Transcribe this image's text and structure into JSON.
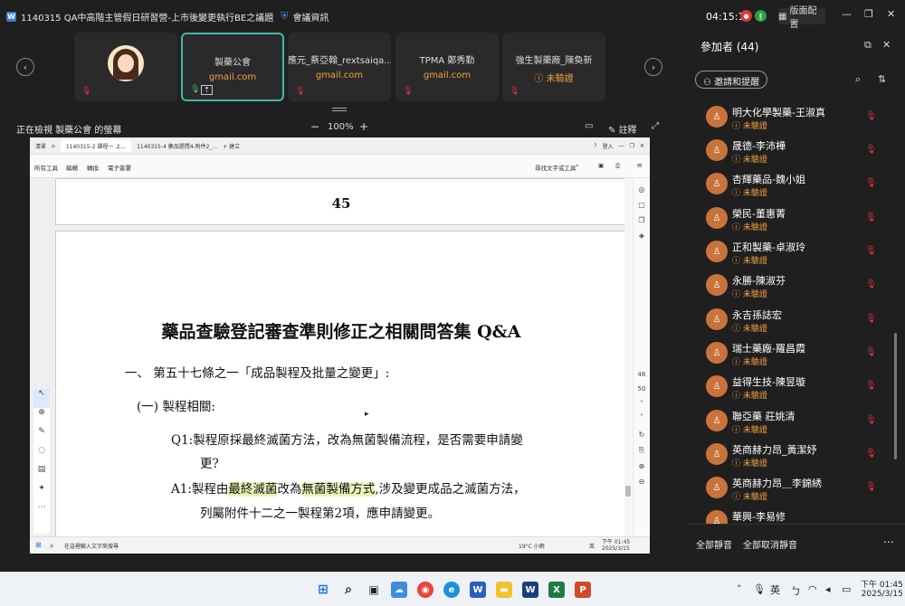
{
  "window": {
    "title": "1140315 QA中高階主管假日研習營-上市後變更執行BE之議題",
    "meeting_info": "會議資訊",
    "time": "04:15:12",
    "layout_label": "版面配置"
  },
  "video_tiles": [
    {
      "name": "",
      "email": ""
    },
    {
      "name": "製藥公會",
      "email": "gmail.com"
    },
    {
      "name": "應元_蔡亞翰_rextsaiqa...",
      "email": "gmail.com"
    },
    {
      "name": "TPMA 鄭秀勤",
      "email": "gmail.com"
    },
    {
      "name": "強生製藥廠_陳奐新",
      "email": "未驗證"
    }
  ],
  "viewing": {
    "label": "正在檢視 製藥公會 的螢幕",
    "zoom": "100%",
    "annotate_label": "註釋"
  },
  "shared_screen": {
    "tabs": [
      "清單",
      "1140315-2 課程一 上...",
      "1140315-4 藥品提問4-附件2_...",
      "+ 建立"
    ],
    "login_label": "登入",
    "toolbar_items": [
      "所有工具",
      "編輯",
      "轉換",
      "電子簽署"
    ],
    "search_label": "尋找文字或工具",
    "page_number_header": "45",
    "doc_title": "藥品查驗登記審查準則修正之相關問答集 Q&A",
    "section_heading": "一、  第五十七條之一「成品製程及批量之變更」:",
    "subsection": "(一) 製程相關:",
    "q1_line1": "Q1:製程原採最終滅菌方法，改為無菌製備流程，是否需要申請變",
    "q1_line2": "更?",
    "a1_prefix": "A1:製程由",
    "a1_hl1": "最終滅菌",
    "a1_mid": "改為",
    "a1_hl2": "無菌製備方式",
    "a1_suffix": ",涉及變更成品之滅菌方法，",
    "a1_line2": "列屬附件十二之一製程第2項，應申請變更。",
    "side_page_current": "46",
    "side_page_total": "50",
    "inner_taskbar": {
      "search_placeholder": "在這裡輸入文字來搜尋",
      "weather": "19°C 小雨",
      "lang": "英",
      "time": "下午 01:45",
      "date": "2025/3/15"
    }
  },
  "participants": {
    "title": "參加者 (44)",
    "invite_label": "邀請和提醒",
    "list": [
      {
        "name": "明大化學製藥-王淑真",
        "status": "未驗證"
      },
      {
        "name": "晟德-李沛樺",
        "status": "未驗證"
      },
      {
        "name": "杏輝藥品-魏小姐",
        "status": "未驗證"
      },
      {
        "name": "榮民-董惠菁",
        "status": "未驗證"
      },
      {
        "name": "正和製藥-卓淑玲",
        "status": "未驗證"
      },
      {
        "name": "永勝-陳淑芬",
        "status": "未驗證"
      },
      {
        "name": "永吉孫誌宏",
        "status": "未驗證"
      },
      {
        "name": "瑞士藥廠-羅昌霞",
        "status": "未驗證"
      },
      {
        "name": "益得生技-陳昱璇",
        "status": "未驗證"
      },
      {
        "name": "聯亞藥 莊姚清",
        "status": "未驗證"
      },
      {
        "name": "英商赫力昂_黃潔妤",
        "status": "未驗證"
      },
      {
        "name": "英商赫力昂＿李錦綉",
        "status": "未驗證"
      },
      {
        "name": "華興-李易修",
        "status": ""
      }
    ],
    "mute_all": "全部靜音",
    "unmute_all": "全部取消靜音"
  },
  "taskbar": {
    "lang": "英",
    "time": "下午 01:45",
    "date": "2025/3/15"
  },
  "colors": {
    "accent": "#f0a040",
    "muted": "#e0343e",
    "avatar": "#c9733c",
    "highlight": "#e9f5b8"
  }
}
